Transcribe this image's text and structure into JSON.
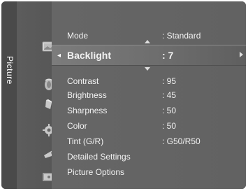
{
  "tab_label": "Picture",
  "icons": [
    "picture-icon",
    "sound-icon",
    "channel-icon",
    "setup-icon",
    "input-icon",
    "application-icon"
  ],
  "menu": {
    "mode": {
      "label": "Mode",
      "value": ": Standard"
    },
    "backlight": {
      "label": "Backlight",
      "value": ": 7"
    },
    "contrast": {
      "label": "Contrast",
      "value": ": 95"
    },
    "brightness": {
      "label": "Brightness",
      "value": ": 45"
    },
    "sharpness": {
      "label": "Sharpness",
      "value": ": 50"
    },
    "color": {
      "label": "Color",
      "value": ": 50"
    },
    "tint": {
      "label": "Tint (G/R)",
      "value": ": G50/R50"
    },
    "detailed_settings": {
      "label": "Detailed Settings"
    },
    "picture_options": {
      "label": "Picture Options"
    }
  }
}
